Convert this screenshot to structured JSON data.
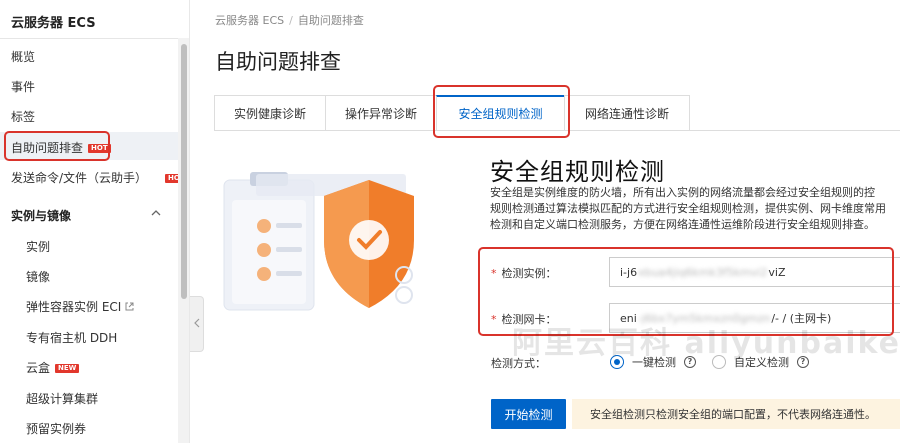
{
  "sidebar": {
    "title": "云服务器 ECS",
    "items": [
      {
        "label": "概览"
      },
      {
        "label": "事件"
      },
      {
        "label": "标签"
      },
      {
        "label": "自助问题排查",
        "badge": "HOT"
      },
      {
        "label": "发送命令/文件（云助手）",
        "badge": "HOT"
      }
    ],
    "section": "实例与镜像",
    "sub_items": [
      {
        "label": "实例"
      },
      {
        "label": "镜像"
      },
      {
        "label": "弹性容器实例 ECI"
      },
      {
        "label": "专有宿主机 DDH"
      },
      {
        "label": "云盒",
        "badge": "NEW"
      },
      {
        "label": "超级计算集群"
      },
      {
        "label": "预留实例券"
      }
    ]
  },
  "breadcrumb": {
    "root": "云服务器 ECS",
    "sep": "/",
    "current": "自助问题排查"
  },
  "page_title": "自助问题排查",
  "tabs": [
    {
      "label": "实例健康诊断"
    },
    {
      "label": "操作异常诊断"
    },
    {
      "label": "安全组规则检测"
    },
    {
      "label": "网络连通性诊断"
    }
  ],
  "content": {
    "title": "安全组规则检测",
    "desc_lines": [
      "安全组是实例维度的防火墙，所有出入实例的网络流量都会经过安全组规则的控",
      "规则检测通过算法模拟匹配的方式进行安全组规则检测，提供实例、网卡维度常用",
      "检测和自定义端口检测服务，方便在网络连通性运维阶段进行安全组规则排查。"
    ]
  },
  "form": {
    "required_mark": "*",
    "instance_label": "检测实例：",
    "instance_value_prefix": "i-j6",
    "instance_value_mask": "xbua4jiq6kmk3f5kmvi2",
    "instance_value_suffix": "viZ",
    "nic_label": "检测网卡：",
    "nic_value_prefix": "eni",
    "nic_value_mask": "-j6bx7ym5kmxzn0gmzn",
    "nic_value_suffix": "/- / (主网卡)",
    "method_label": "检测方式：",
    "method_options": [
      {
        "label": "一键检测",
        "checked": true
      },
      {
        "label": "自定义检测",
        "checked": false
      }
    ],
    "help_glyph": "?"
  },
  "actions": {
    "start_label": "开始检测",
    "notice": "安全组检测只检测安全组的端口配置，不代表网络连通性。"
  },
  "watermark": "阿里云百科 aliyunbaike.com",
  "colors": {
    "primary": "#0064c8",
    "highlight": "#d9332b",
    "hot": "#e2372c",
    "shield": "#f07d2a"
  },
  "icons": [
    "chevron-up-icon",
    "external-link-icon",
    "chevron-left-icon",
    "shield-check-icon",
    "checklist-icon",
    "help-icon"
  ]
}
